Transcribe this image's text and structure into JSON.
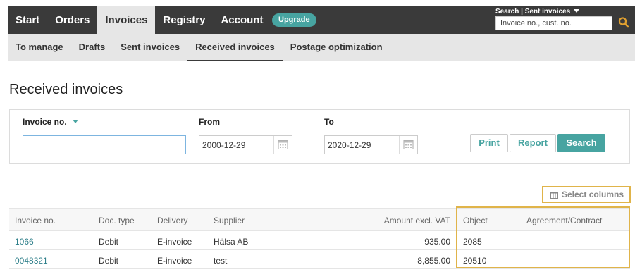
{
  "topnav": {
    "items": [
      {
        "label": "Start",
        "active": false
      },
      {
        "label": "Orders",
        "active": false
      },
      {
        "label": "Invoices",
        "active": true
      },
      {
        "label": "Registry",
        "active": false
      },
      {
        "label": "Account",
        "active": false
      }
    ],
    "upgrade_label": "Upgrade",
    "search_label": "Search | Sent invoices",
    "search_placeholder": "Invoice no., cust. no."
  },
  "subnav": {
    "items": [
      {
        "label": "To manage",
        "active": false
      },
      {
        "label": "Drafts",
        "active": false
      },
      {
        "label": "Sent invoices",
        "active": false
      },
      {
        "label": "Received invoices",
        "active": true
      },
      {
        "label": "Postage optimization",
        "active": false
      }
    ]
  },
  "page_title": "Received invoices",
  "filter": {
    "invoice_label": "Invoice no.",
    "invoice_value": "",
    "from_label": "From",
    "from_value": "2000-12-29",
    "to_label": "To",
    "to_value": "2020-12-29",
    "print_label": "Print",
    "report_label": "Report",
    "search_label": "Search"
  },
  "select_columns_label": "Select columns",
  "table": {
    "headers": {
      "invoice_no": "Invoice no.",
      "doc_type": "Doc. type",
      "delivery": "Delivery",
      "supplier": "Supplier",
      "amount": "Amount excl. VAT",
      "object": "Object",
      "agreement": "Agreement/Contract"
    },
    "rows": [
      {
        "invoice_no": "1066",
        "doc_type": "Debit",
        "delivery": "E-invoice",
        "supplier": "Hälsa AB",
        "amount": "935.00",
        "object": "2085",
        "agreement": ""
      },
      {
        "invoice_no": "0048321",
        "doc_type": "Debit",
        "delivery": "E-invoice",
        "supplier": "test",
        "amount": "8,855.00",
        "object": "20510",
        "agreement": ""
      }
    ]
  },
  "colors": {
    "accent": "#47a4a1",
    "topbar": "#3a3a3a",
    "subbar": "#e6e6e6",
    "highlight": "#e0b44a",
    "link": "#2e7f8a"
  }
}
